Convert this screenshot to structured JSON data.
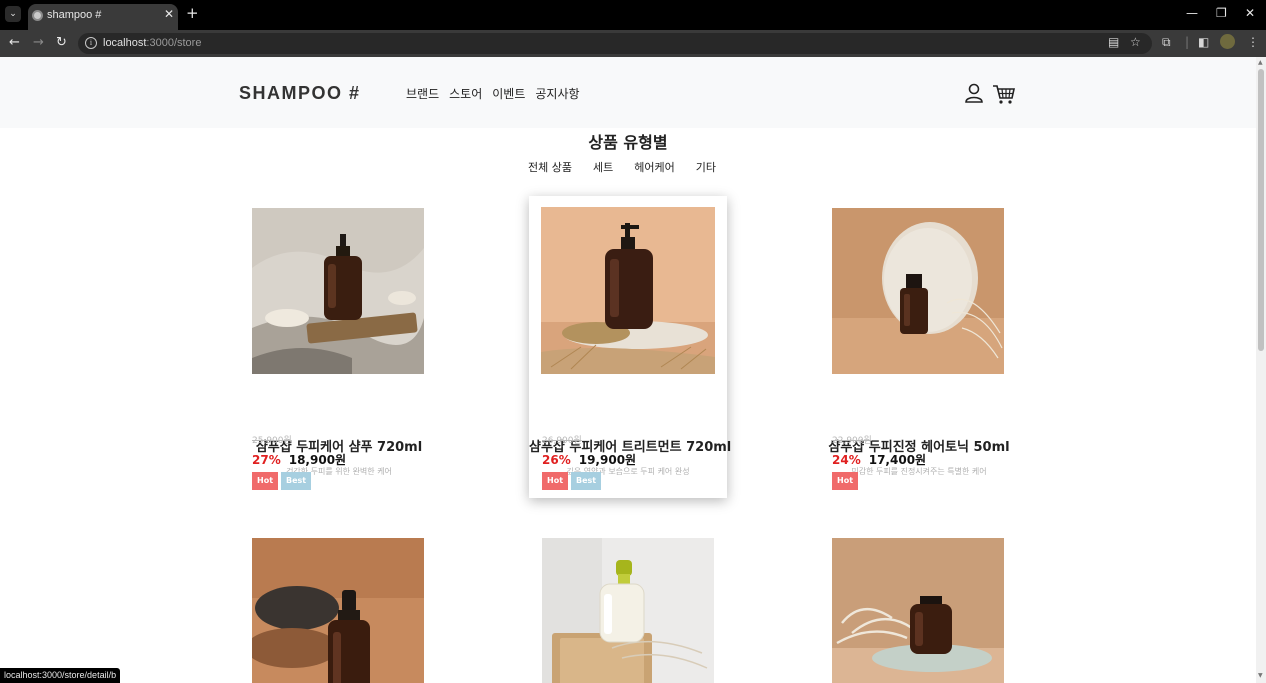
{
  "browser": {
    "tab_title": "shampoo #",
    "url_host": "localhost",
    "url_path": ":3000/store",
    "status_url": "localhost:3000/store/detail/b"
  },
  "site": {
    "logo": "SHAMPOO #",
    "nav": [
      "브랜드",
      "스토어",
      "이벤트",
      "공지사항"
    ]
  },
  "section": {
    "title": "상품 유형별",
    "tabs": [
      "전체 상품",
      "세트",
      "헤어케어",
      "기타"
    ]
  },
  "products": [
    {
      "name": "샴푸샵 두피케어 샴푸 720ml",
      "desc": "건강한 두피를 위한 완벽한 케어",
      "original_price": "25,900원",
      "discount": "27%",
      "price": "18,900원",
      "badges": [
        "Hot",
        "Best"
      ]
    },
    {
      "name": "샴푸샵 두피케어 트리트먼트 720ml",
      "desc": "깊은 영양과 보습으로 두피 케어 완성",
      "original_price": "26,900원",
      "discount": "26%",
      "price": "19,900원",
      "badges": [
        "Hot",
        "Best"
      ]
    },
    {
      "name": "샴푸샵 두피진정 헤어토닉 50ml",
      "desc": "민감한 두피를 진정시켜주는 특별한 케어",
      "original_price": "22,900원",
      "discount": "24%",
      "price": "17,400원",
      "badges": [
        "Hot"
      ]
    }
  ],
  "colors": {
    "discount": "#e02020",
    "badge_hot": "#f06a6a",
    "badge_best": "#a7cfe0",
    "header_bg": "#f8f9fa"
  }
}
